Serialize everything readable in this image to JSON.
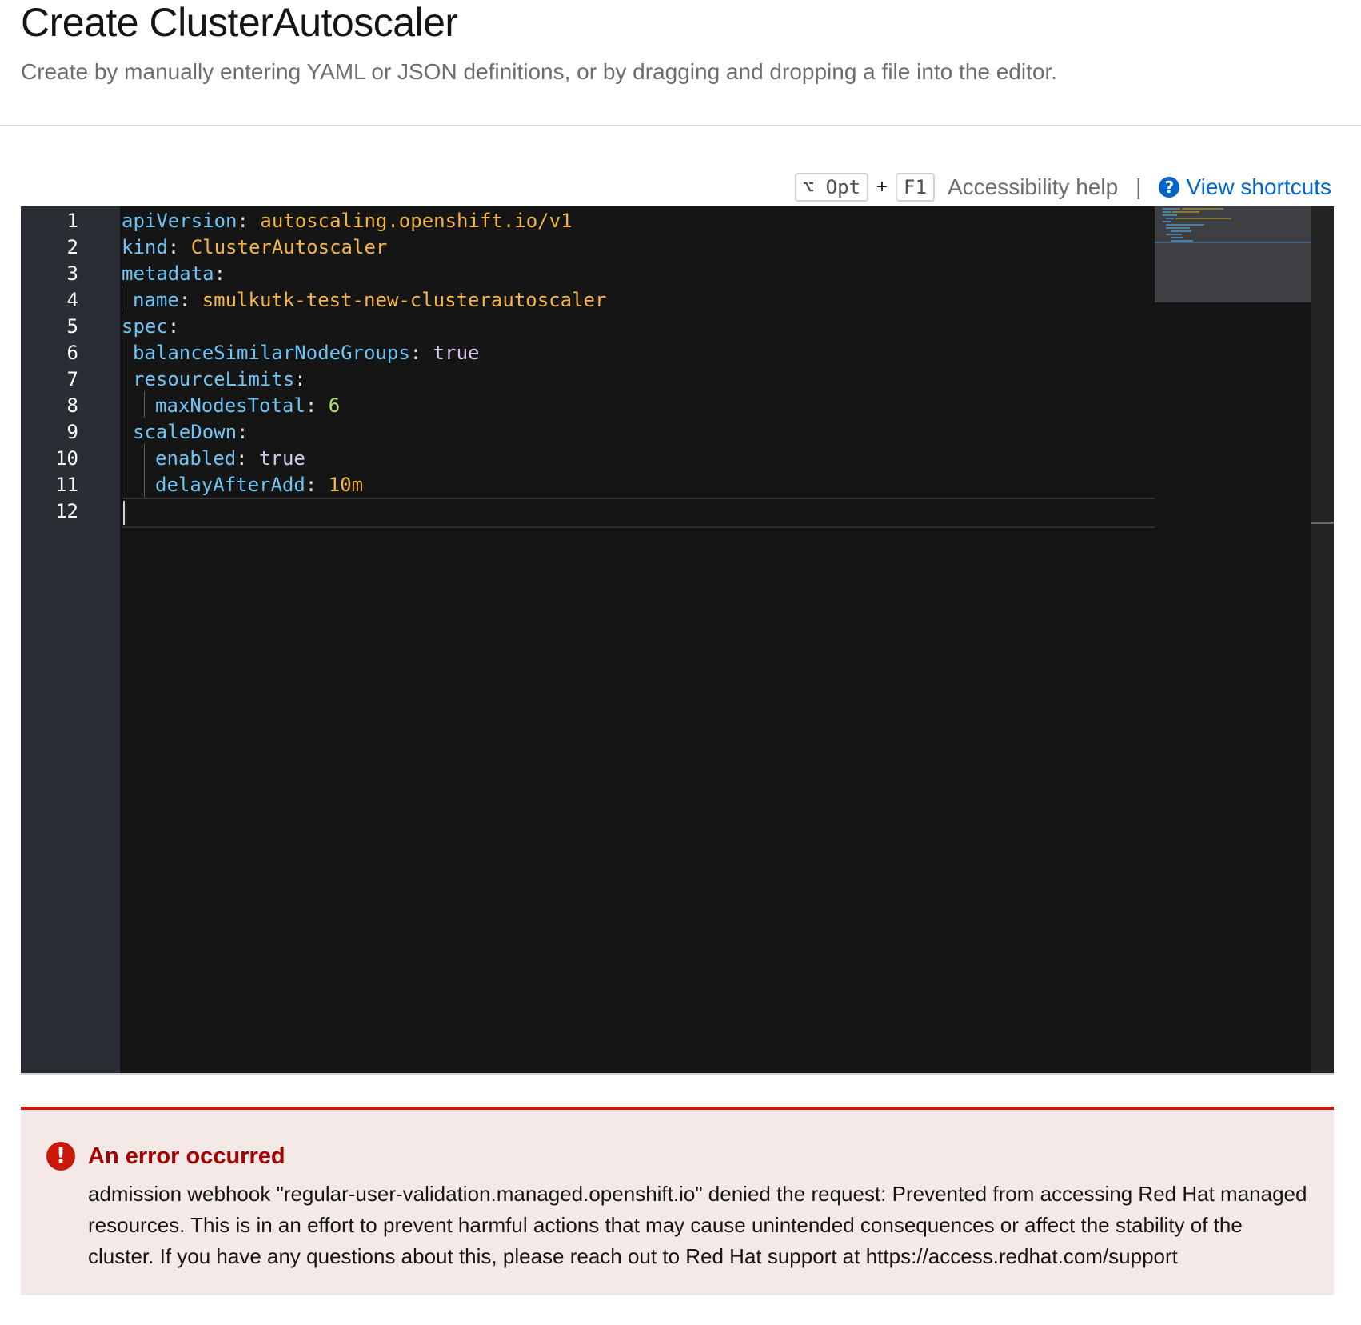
{
  "header": {
    "title": "Create ClusterAutoscaler",
    "subtitle": "Create by manually entering YAML or JSON definitions, or by dragging and dropping a file into the editor."
  },
  "shortcuts": {
    "key1": "⌥ Opt",
    "plus": "+",
    "key2": "F1",
    "accessibility_help": "Accessibility help",
    "separator": "|",
    "view_shortcuts": "View shortcuts",
    "help_icon": "question-circle-icon",
    "link_color": "#0066cc"
  },
  "editor": {
    "language": "yaml",
    "line_numbers": [
      "1",
      "2",
      "3",
      "4",
      "5",
      "6",
      "7",
      "8",
      "9",
      "10",
      "11",
      "12"
    ],
    "lines": [
      {
        "key": "apiVersion",
        "sep": ":",
        "value": " autoscaling.openshift.io/v1"
      },
      {
        "key": "kind",
        "sep": ":",
        "value": " ClusterAutoscaler"
      },
      {
        "key": "metadata",
        "sep": ":",
        "value": ""
      },
      {
        "key": "name",
        "sep": ":",
        "value": " smulkutk-test-new-clusterautoscaler"
      },
      {
        "key": "spec",
        "sep": ":",
        "value": ""
      },
      {
        "key": "balanceSimilarNodeGroups",
        "sep": ":",
        "value": " true"
      },
      {
        "key": "resourceLimits",
        "sep": ":",
        "value": ""
      },
      {
        "key": "maxNodesTotal",
        "sep": ":",
        "value": " 6"
      },
      {
        "key": "scaleDown",
        "sep": ":",
        "value": ""
      },
      {
        "key": "enabled",
        "sep": ":",
        "value": " true"
      },
      {
        "key": "delayAfterAdd",
        "sep": ":",
        "value": " 10m"
      },
      {
        "key": "",
        "sep": "",
        "value": ""
      }
    ],
    "colors": {
      "background": "#151515",
      "gutter": "#292e34",
      "key": "#6ec4f4",
      "string": "#f4b543",
      "boolean": "#d8c6f0",
      "number": "#b4e36c"
    }
  },
  "alert": {
    "icon": "exclamation-circle-icon",
    "title": "An error occurred",
    "message": "admission webhook \"regular-user-validation.managed.openshift.io\" denied the request: Prevented from accessing Red Hat managed resources. This is in an effort to prevent harmful actions that may cause unintended consequences or affect the stability of the cluster. If you have any questions about this, please reach out to Red Hat support at https://access.redhat.com/support",
    "color": "#c9190b"
  }
}
